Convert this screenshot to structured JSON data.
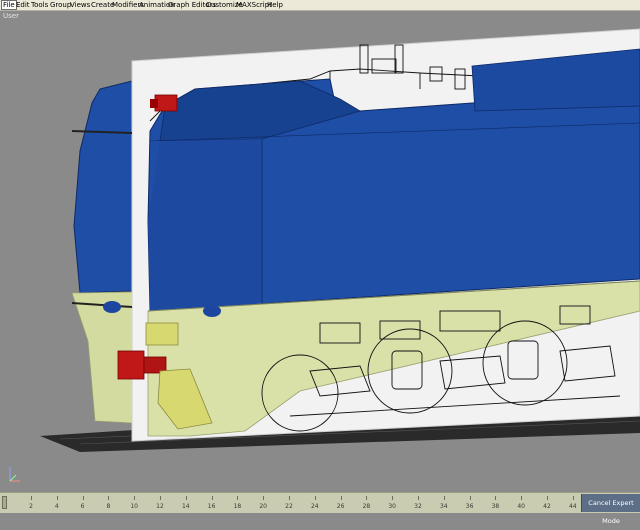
{
  "menubar": {
    "items": [
      "File",
      "Edit",
      "Tools",
      "Group",
      "Views",
      "Create",
      "Modifiers",
      "Animation",
      "Graph Editors",
      "Customize",
      "MAXScript",
      "Help"
    ]
  },
  "viewport": {
    "label": "User",
    "scene": {
      "objects": [
        "locomotive-body",
        "blueprint-plane",
        "bogie-drawing",
        "buffer-left",
        "buffer-right",
        "coupler",
        "ground-grid"
      ],
      "colors": {
        "viewport_bg": "#8a8a8a",
        "body_blue": "#1f4ea6",
        "body_blue_dark": "#143a86",
        "underframe_yellow": "#d9e0a8",
        "blueprint_white": "#f2f2f2",
        "buffer_red": "#c01818",
        "coupler_yellow": "#d8d870",
        "grid_dark": "#2a2a2a"
      }
    }
  },
  "timeline": {
    "ticks": [
      "2",
      "4",
      "6",
      "8",
      "10",
      "12",
      "14",
      "16",
      "18",
      "20",
      "22",
      "24",
      "26",
      "28",
      "30",
      "32",
      "34",
      "36",
      "38",
      "40",
      "42",
      "44"
    ],
    "current_frame": 0
  },
  "status": {
    "cancel_expert_mode": "Cancel Expert Mode"
  }
}
